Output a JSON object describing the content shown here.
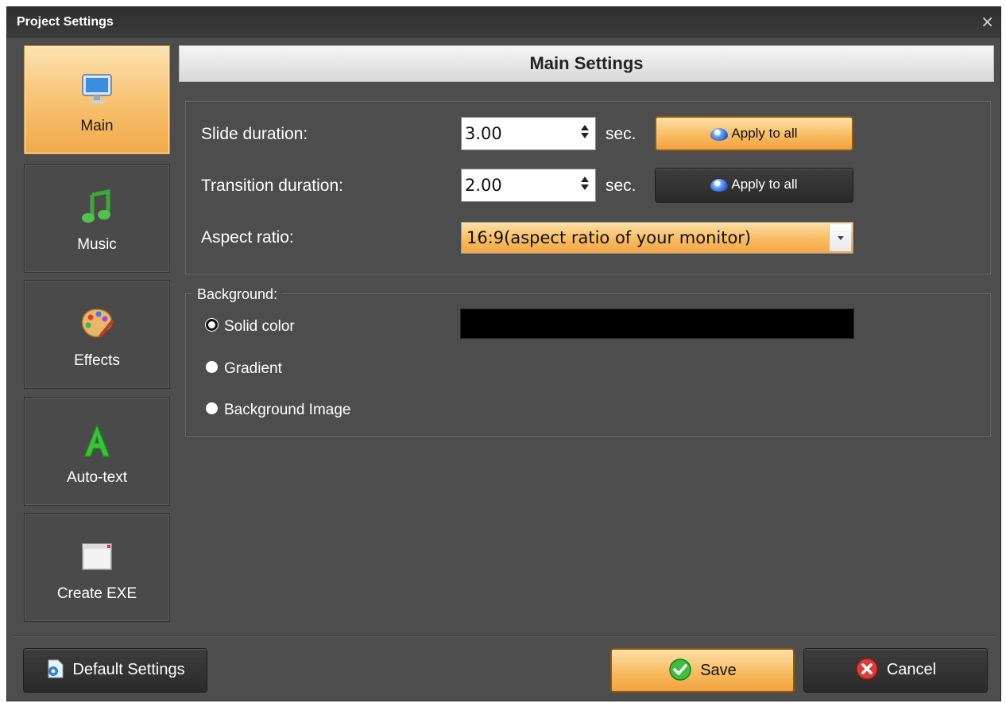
{
  "window": {
    "title": "Project Settings",
    "close_glyph": "×"
  },
  "sidebar": {
    "items": [
      {
        "label": "Main",
        "icon": "monitor-icon",
        "active": true
      },
      {
        "label": "Music",
        "icon": "music-note-icon",
        "active": false
      },
      {
        "label": "Effects",
        "icon": "palette-icon",
        "active": false
      },
      {
        "label": "Auto-text",
        "icon": "letter-a-icon",
        "active": false
      },
      {
        "label": "Create EXE",
        "icon": "window-icon",
        "active": false
      }
    ]
  },
  "main": {
    "header": "Main Settings",
    "slide_duration": {
      "label": "Slide duration:",
      "value": "3.00",
      "unit": "sec.",
      "apply_label": "Apply to all"
    },
    "transition_duration": {
      "label": "Transition duration:",
      "value": "2.00",
      "unit": "sec.",
      "apply_label": "Apply to all"
    },
    "aspect_ratio": {
      "label": "Aspect ratio:",
      "value": "16:9(aspect ratio of your monitor)"
    },
    "background": {
      "legend": "Background:",
      "options": [
        {
          "label": "Solid color",
          "checked": true
        },
        {
          "label": "Gradient",
          "checked": false
        },
        {
          "label": "Background Image",
          "checked": false
        }
      ],
      "solid_color": "#000000"
    }
  },
  "footer": {
    "default_settings_label": "Default Settings",
    "save_label": "Save",
    "cancel_label": "Cancel"
  },
  "colors": {
    "accent_orange": "#f7b95c",
    "panel_bg": "#4d4d4d",
    "dark_button": "#2f2f2f"
  }
}
